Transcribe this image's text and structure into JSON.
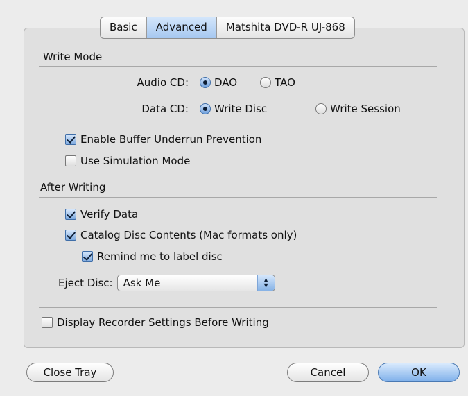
{
  "tabs": [
    "Basic",
    "Advanced",
    "Matshita DVD-R   UJ-868"
  ],
  "selected_tab": "Advanced",
  "write_mode": {
    "title": "Write Mode",
    "audio_cd": {
      "label": "Audio CD:",
      "options": [
        "DAO",
        "TAO"
      ],
      "selected": "DAO"
    },
    "data_cd": {
      "label": "Data CD:",
      "options": [
        "Write Disc",
        "Write Session"
      ],
      "selected": "Write Disc"
    },
    "buffer_underrun": {
      "label": "Enable Buffer Underrun Prevention",
      "checked": true
    },
    "simulation": {
      "label": "Use Simulation Mode",
      "checked": false
    }
  },
  "after_writing": {
    "title": "After Writing",
    "verify": {
      "label": "Verify Data",
      "checked": true
    },
    "catalog": {
      "label": "Catalog Disc Contents (Mac formats only)",
      "checked": true
    },
    "remind": {
      "label": "Remind me to label disc",
      "checked": true
    },
    "eject": {
      "label": "Eject Disc:",
      "value": "Ask Me"
    }
  },
  "display_settings": {
    "label": "Display Recorder Settings Before Writing",
    "checked": false
  },
  "buttons": {
    "close_tray": "Close Tray",
    "cancel": "Cancel",
    "ok": "OK"
  },
  "icons": {
    "popup_arrows": "updown-arrows-icon"
  }
}
